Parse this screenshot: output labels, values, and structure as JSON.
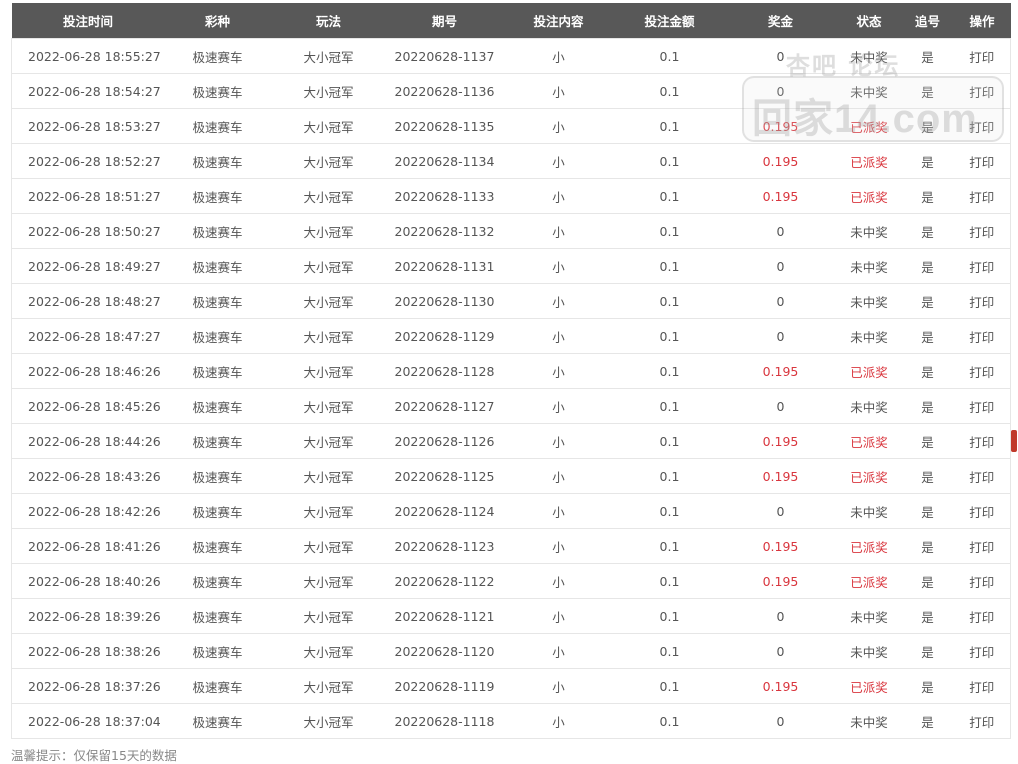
{
  "table": {
    "headers": [
      "投注时间",
      "彩种",
      "玩法",
      "期号",
      "投注内容",
      "投注金额",
      "奖金",
      "状态",
      "追号",
      "操作"
    ],
    "rows": [
      {
        "time": "2022-06-28 18:55:27",
        "lottery": "极速赛车",
        "play": "大小冠军",
        "issue": "20220628-1137",
        "content": "小",
        "amount": "0.1",
        "prize": "0",
        "status": "未中奖",
        "chase": "是",
        "action": "打印",
        "won": false
      },
      {
        "time": "2022-06-28 18:54:27",
        "lottery": "极速赛车",
        "play": "大小冠军",
        "issue": "20220628-1136",
        "content": "小",
        "amount": "0.1",
        "prize": "0",
        "status": "未中奖",
        "chase": "是",
        "action": "打印",
        "won": false
      },
      {
        "time": "2022-06-28 18:53:27",
        "lottery": "极速赛车",
        "play": "大小冠军",
        "issue": "20220628-1135",
        "content": "小",
        "amount": "0.1",
        "prize": "0.195",
        "status": "已派奖",
        "chase": "是",
        "action": "打印",
        "won": true
      },
      {
        "time": "2022-06-28 18:52:27",
        "lottery": "极速赛车",
        "play": "大小冠军",
        "issue": "20220628-1134",
        "content": "小",
        "amount": "0.1",
        "prize": "0.195",
        "status": "已派奖",
        "chase": "是",
        "action": "打印",
        "won": true
      },
      {
        "time": "2022-06-28 18:51:27",
        "lottery": "极速赛车",
        "play": "大小冠军",
        "issue": "20220628-1133",
        "content": "小",
        "amount": "0.1",
        "prize": "0.195",
        "status": "已派奖",
        "chase": "是",
        "action": "打印",
        "won": true
      },
      {
        "time": "2022-06-28 18:50:27",
        "lottery": "极速赛车",
        "play": "大小冠军",
        "issue": "20220628-1132",
        "content": "小",
        "amount": "0.1",
        "prize": "0",
        "status": "未中奖",
        "chase": "是",
        "action": "打印",
        "won": false
      },
      {
        "time": "2022-06-28 18:49:27",
        "lottery": "极速赛车",
        "play": "大小冠军",
        "issue": "20220628-1131",
        "content": "小",
        "amount": "0.1",
        "prize": "0",
        "status": "未中奖",
        "chase": "是",
        "action": "打印",
        "won": false
      },
      {
        "time": "2022-06-28 18:48:27",
        "lottery": "极速赛车",
        "play": "大小冠军",
        "issue": "20220628-1130",
        "content": "小",
        "amount": "0.1",
        "prize": "0",
        "status": "未中奖",
        "chase": "是",
        "action": "打印",
        "won": false
      },
      {
        "time": "2022-06-28 18:47:27",
        "lottery": "极速赛车",
        "play": "大小冠军",
        "issue": "20220628-1129",
        "content": "小",
        "amount": "0.1",
        "prize": "0",
        "status": "未中奖",
        "chase": "是",
        "action": "打印",
        "won": false
      },
      {
        "time": "2022-06-28 18:46:26",
        "lottery": "极速赛车",
        "play": "大小冠军",
        "issue": "20220628-1128",
        "content": "小",
        "amount": "0.1",
        "prize": "0.195",
        "status": "已派奖",
        "chase": "是",
        "action": "打印",
        "won": true
      },
      {
        "time": "2022-06-28 18:45:26",
        "lottery": "极速赛车",
        "play": "大小冠军",
        "issue": "20220628-1127",
        "content": "小",
        "amount": "0.1",
        "prize": "0",
        "status": "未中奖",
        "chase": "是",
        "action": "打印",
        "won": false
      },
      {
        "time": "2022-06-28 18:44:26",
        "lottery": "极速赛车",
        "play": "大小冠军",
        "issue": "20220628-1126",
        "content": "小",
        "amount": "0.1",
        "prize": "0.195",
        "status": "已派奖",
        "chase": "是",
        "action": "打印",
        "won": true
      },
      {
        "time": "2022-06-28 18:43:26",
        "lottery": "极速赛车",
        "play": "大小冠军",
        "issue": "20220628-1125",
        "content": "小",
        "amount": "0.1",
        "prize": "0.195",
        "status": "已派奖",
        "chase": "是",
        "action": "打印",
        "won": true
      },
      {
        "time": "2022-06-28 18:42:26",
        "lottery": "极速赛车",
        "play": "大小冠军",
        "issue": "20220628-1124",
        "content": "小",
        "amount": "0.1",
        "prize": "0",
        "status": "未中奖",
        "chase": "是",
        "action": "打印",
        "won": false
      },
      {
        "time": "2022-06-28 18:41:26",
        "lottery": "极速赛车",
        "play": "大小冠军",
        "issue": "20220628-1123",
        "content": "小",
        "amount": "0.1",
        "prize": "0.195",
        "status": "已派奖",
        "chase": "是",
        "action": "打印",
        "won": true
      },
      {
        "time": "2022-06-28 18:40:26",
        "lottery": "极速赛车",
        "play": "大小冠军",
        "issue": "20220628-1122",
        "content": "小",
        "amount": "0.1",
        "prize": "0.195",
        "status": "已派奖",
        "chase": "是",
        "action": "打印",
        "won": true
      },
      {
        "time": "2022-06-28 18:39:26",
        "lottery": "极速赛车",
        "play": "大小冠军",
        "issue": "20220628-1121",
        "content": "小",
        "amount": "0.1",
        "prize": "0",
        "status": "未中奖",
        "chase": "是",
        "action": "打印",
        "won": false
      },
      {
        "time": "2022-06-28 18:38:26",
        "lottery": "极速赛车",
        "play": "大小冠军",
        "issue": "20220628-1120",
        "content": "小",
        "amount": "0.1",
        "prize": "0",
        "status": "未中奖",
        "chase": "是",
        "action": "打印",
        "won": false
      },
      {
        "time": "2022-06-28 18:37:26",
        "lottery": "极速赛车",
        "play": "大小冠军",
        "issue": "20220628-1119",
        "content": "小",
        "amount": "0.1",
        "prize": "0.195",
        "status": "已派奖",
        "chase": "是",
        "action": "打印",
        "won": true
      },
      {
        "time": "2022-06-28 18:37:04",
        "lottery": "极速赛车",
        "play": "大小冠军",
        "issue": "20220628-1118",
        "content": "小",
        "amount": "0.1",
        "prize": "0",
        "status": "未中奖",
        "chase": "是",
        "action": "打印",
        "won": false
      }
    ]
  },
  "hint": "温馨提示：仅保留15天的数据",
  "watermark": {
    "top": "杏吧 论坛",
    "main": "回家14.com"
  },
  "colors": {
    "header_bg": "#585858",
    "header_text": "#ffffff",
    "won_text": "#d9363e",
    "body_text": "#555555",
    "border": "#e6e6e6"
  }
}
